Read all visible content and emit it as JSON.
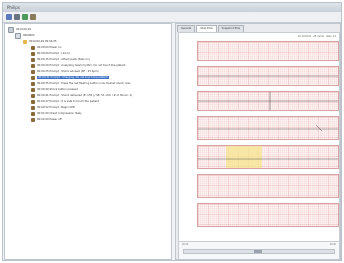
{
  "window": {
    "title": "Philips"
  },
  "toolbar": {
    "icons": [
      "save-icon",
      "print-icon",
      "refresh-icon",
      "settings-icon"
    ]
  },
  "tree": {
    "root": "2010-09-29",
    "child": "0000003",
    "session": "2010-09-29 09:54:05",
    "events": [
      "00:00:00 Power on",
      "00:00:09 Prompt : Link to",
      "00:00:15 Prompt : Attach pads (Pads on)",
      "00:00:20 Prompt : Analyzing heart rhythm. Do not touch the patient",
      "00:00:25 Prompt : Shock advised (RF : 25 bpm)",
      "00:00:31 Prompt : Charging. Do not touch the patient",
      "00:00:35 Prompt : Press the red flashing button now. Deliver shock now.",
      "00:00:40 Shock button pressed",
      "00:00:41 Prompt : Shock delivered (E: 155 J / SE: 51 ohm / # of Shock: 1)",
      "00:00:47 Prompt : It is safe to touch the patient",
      "00:00:52 Prompt : Begin CPR",
      "00:01:00 Chest compression likely",
      "00:02:00 Power off"
    ]
  },
  "tabs": [
    "General",
    "Strip ECG",
    "Snapshot ECG"
  ],
  "plot": {
    "scale": "10 mm/mV · 25 mm/s · Gain ×1"
  },
  "bottom": {
    "left": "00:00",
    "right": "00:00"
  },
  "colors": {
    "accent": "#3d6fc4",
    "grid": "#e9b4b4",
    "highlight": "#f6e48e"
  }
}
